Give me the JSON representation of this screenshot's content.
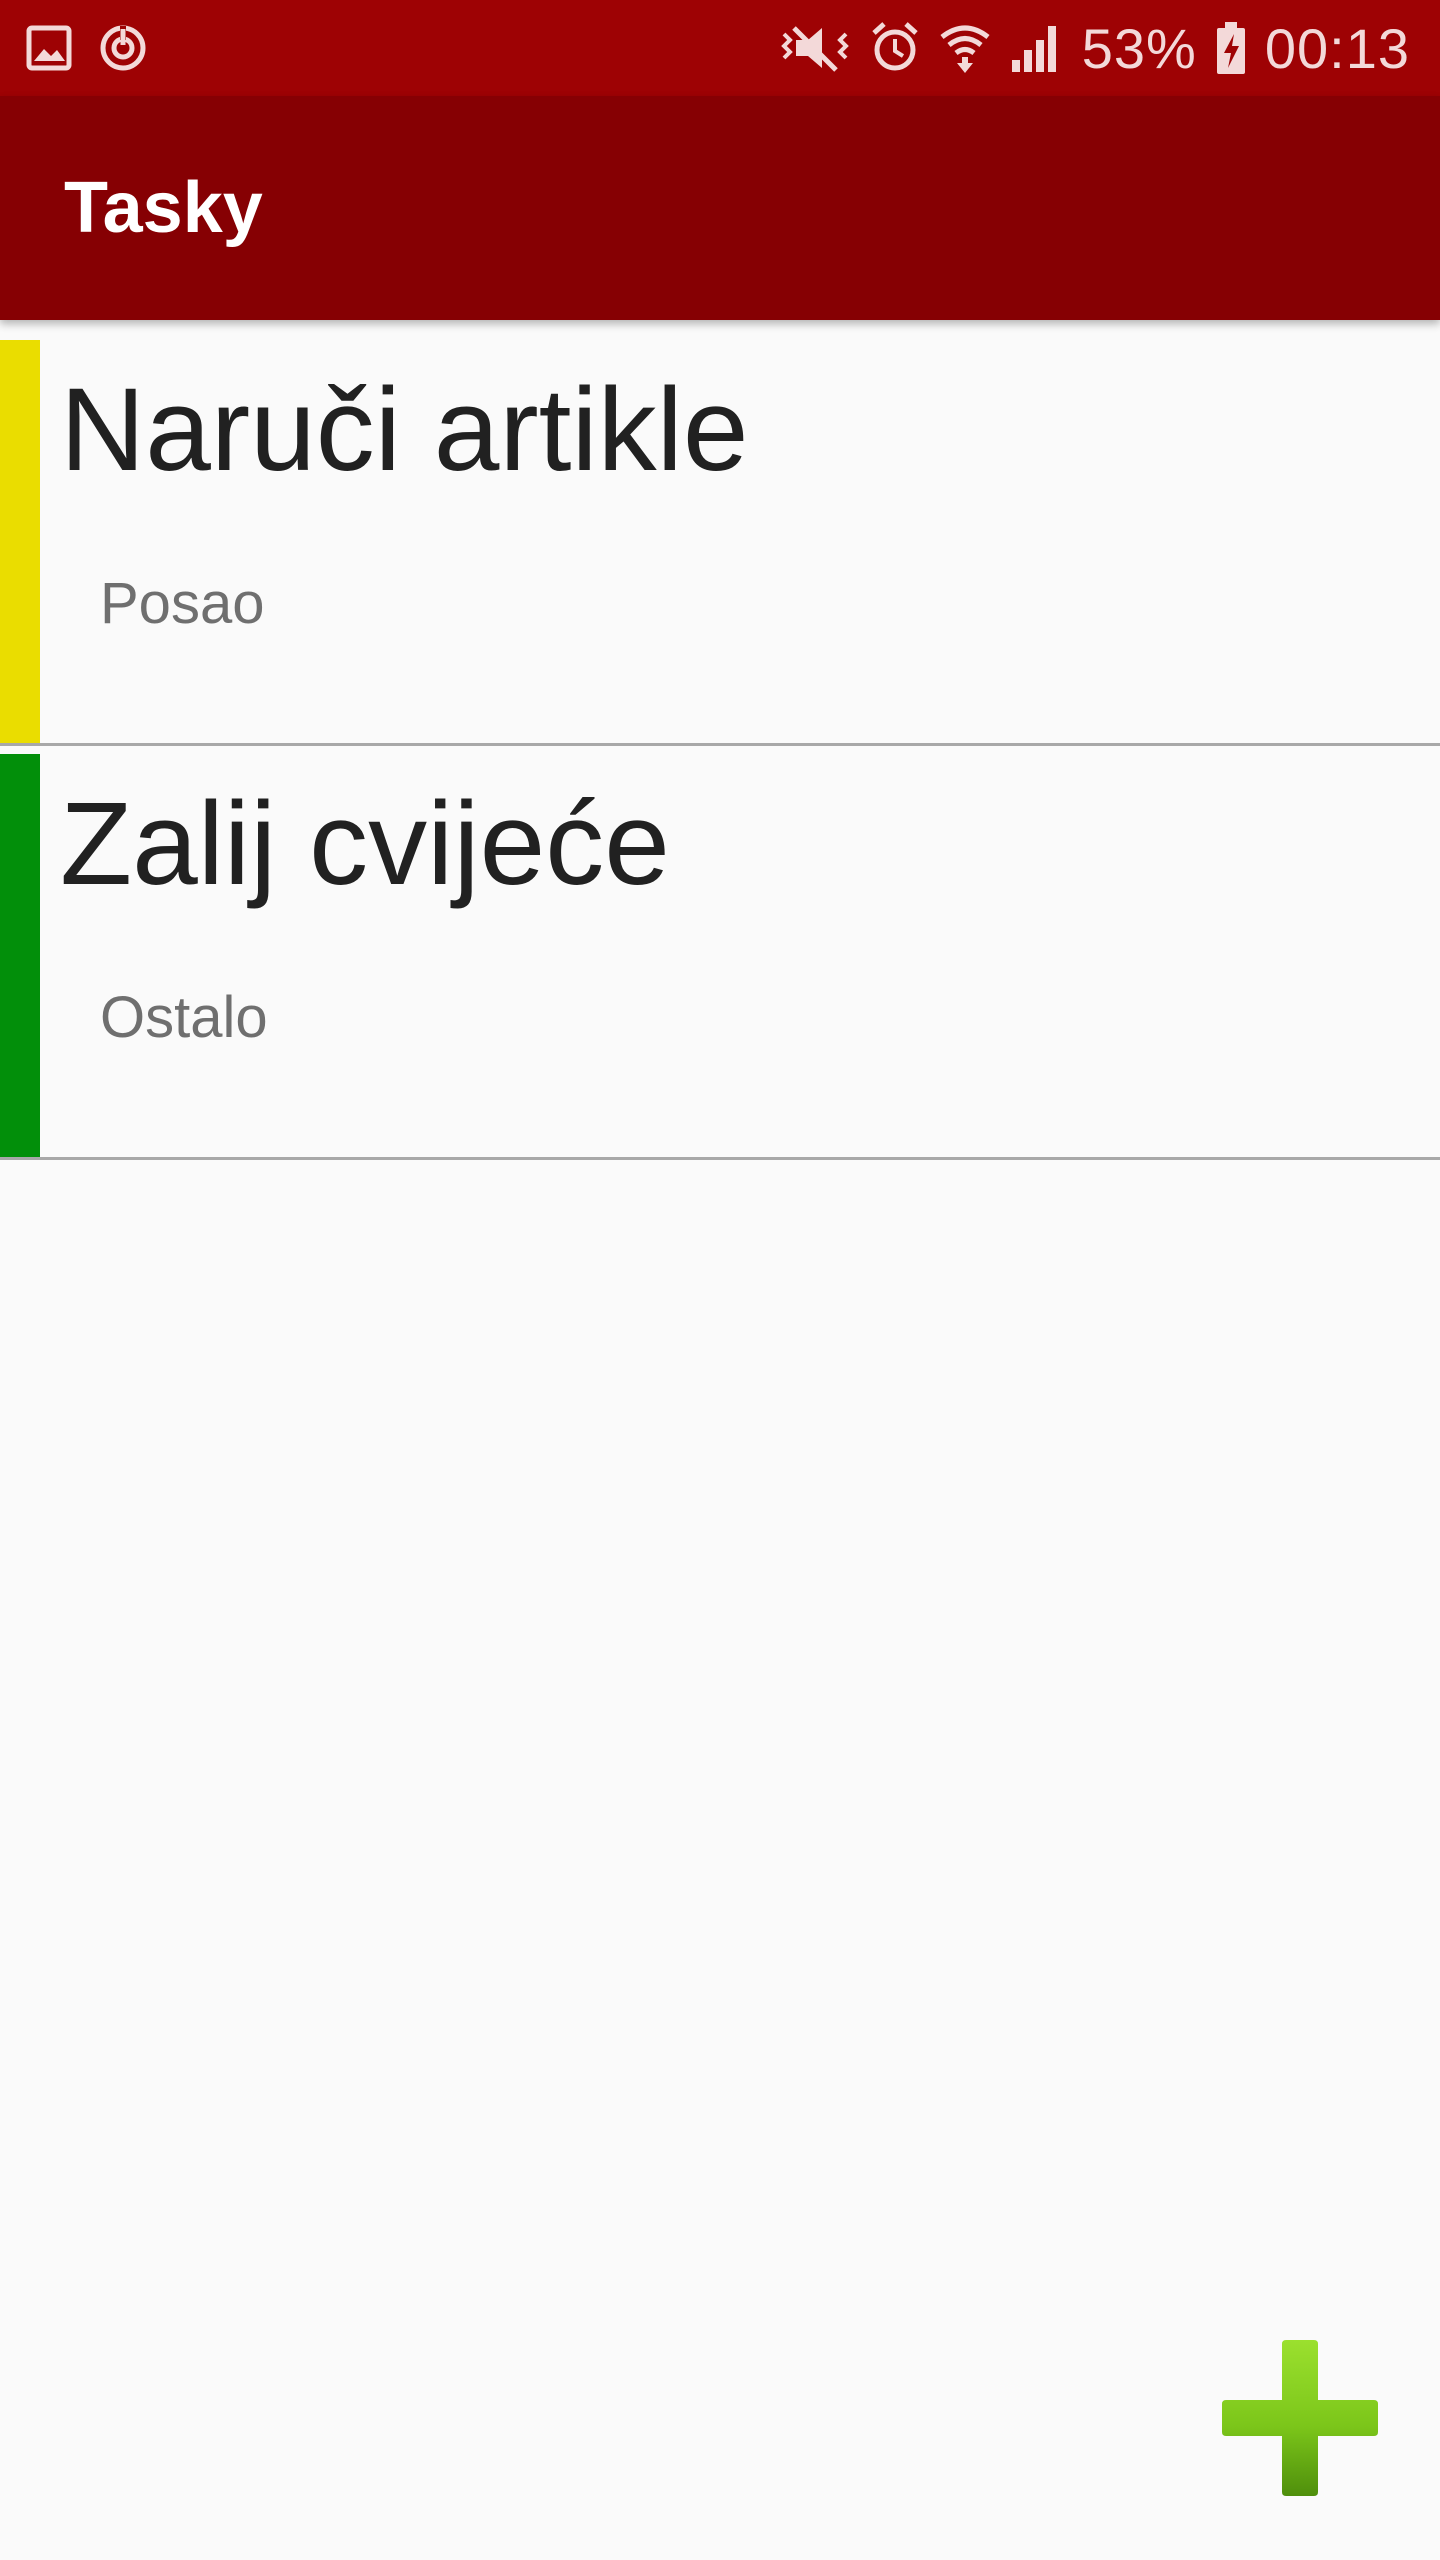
{
  "status_bar": {
    "battery": "53%",
    "time": "00:13",
    "icons": [
      "image-notification-icon",
      "sync-notification-icon",
      "vibrate-icon",
      "alarm-icon",
      "wifi-icon",
      "signal-icon",
      "battery-charging-icon"
    ]
  },
  "app_bar": {
    "title": "Tasky"
  },
  "tasks": [
    {
      "title": "Naruči artikle",
      "category": "Posao",
      "color": "#eadd00"
    },
    {
      "title": "Zalij cvijeće",
      "category": "Ostalo",
      "color": "#028f0a"
    }
  ],
  "fab": {
    "icon": "add-icon",
    "color": "#7cc61a"
  }
}
